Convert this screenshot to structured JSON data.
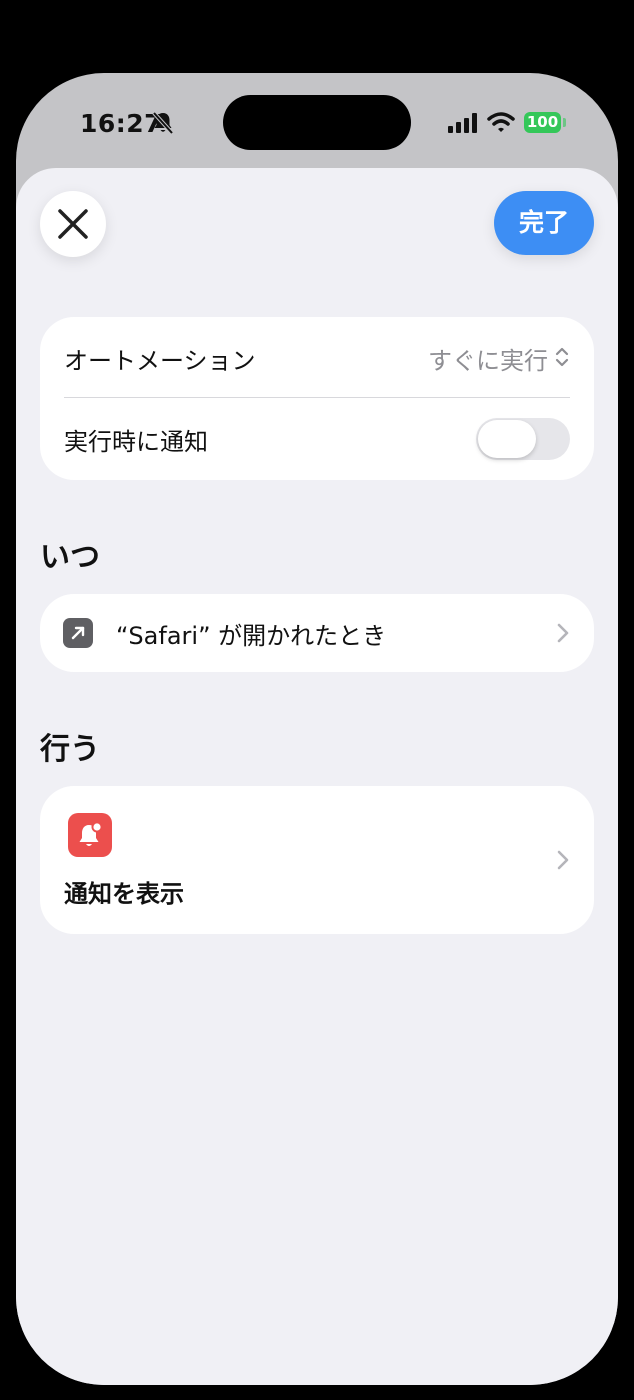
{
  "status_bar": {
    "time": "16:27",
    "battery": "100",
    "icons": [
      "bell-slash-icon",
      "cellular-signal-icon",
      "wifi-icon",
      "battery-icon"
    ]
  },
  "toolbar": {
    "close_icon": "close-icon",
    "done_label": "完了"
  },
  "settings": {
    "automation_label": "オートメーション",
    "automation_value": "すぐに実行",
    "notify_label": "実行時に通知",
    "notify_on": false
  },
  "when": {
    "title": "いつ",
    "trigger_label": "“Safari” が開かれたとき",
    "trigger_icon": "app-open-arrow-icon"
  },
  "do": {
    "title": "行う",
    "action_label": "通知を表示",
    "action_icon": "notification-bell-icon"
  },
  "colors": {
    "accent": "#3d8ef4",
    "battery": "#34c759",
    "action_icon_bg": "#ec4f4d",
    "sheet_bg": "#f0f0f5"
  }
}
